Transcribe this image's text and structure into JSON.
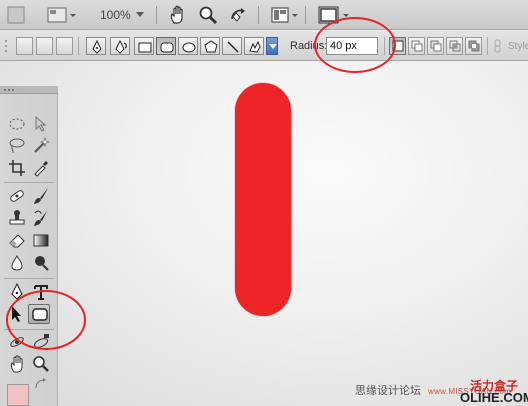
{
  "appbar": {
    "zoom_label": "100%",
    "icons": [
      "hand-icon",
      "zoom-icon",
      "rotate-view-icon",
      "arrange-documents-icon",
      "screen-mode-icon"
    ]
  },
  "options": {
    "radius_label": "Radius:",
    "radius_value": "40 px",
    "style_label": "Style",
    "active_shape_tool": "rounded-rectangle"
  },
  "tools": {
    "active_tool": "rounded-rectangle-tool",
    "foreground_color": "#efc3c3"
  },
  "canvas": {
    "shape": "rounded-rectangle",
    "fill_color": "#ee2427"
  },
  "annotations": {
    "color": "#e82323"
  },
  "watermark": {
    "site_cn": "思缘设计论坛",
    "site_en": "www.MISSYUAN.com",
    "brand_cn": "活力盒子",
    "brand_en": "OLIHE.COM"
  }
}
